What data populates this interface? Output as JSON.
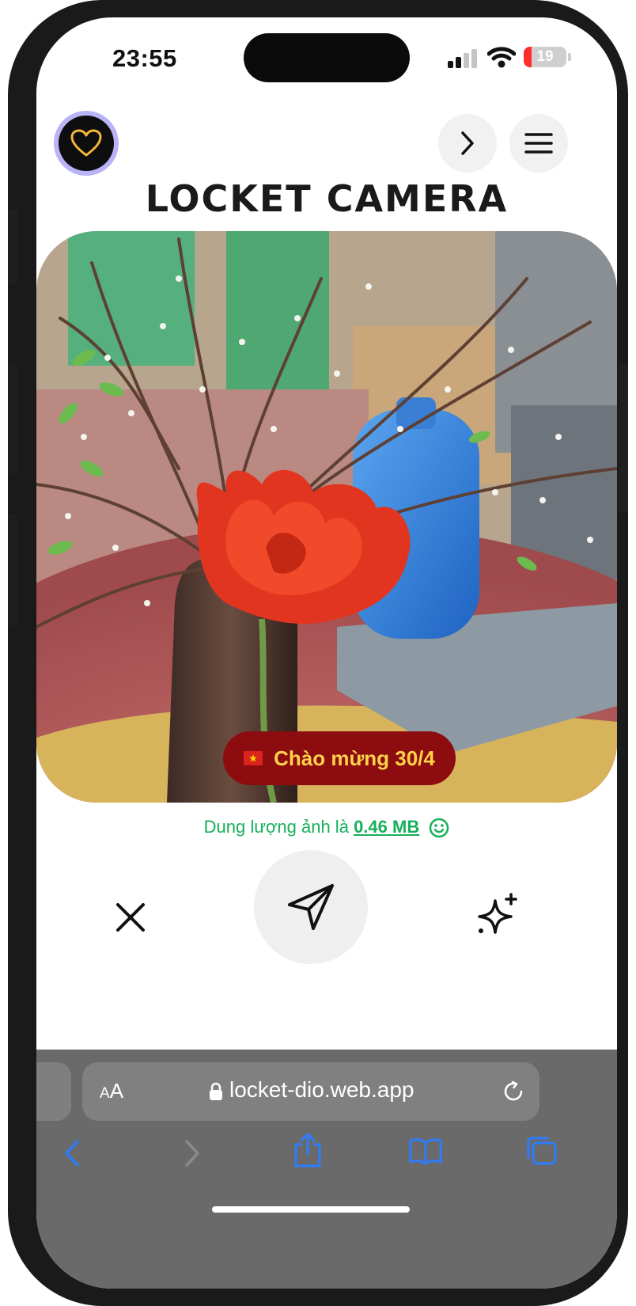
{
  "status_bar": {
    "time": "23:55",
    "battery_level": "19",
    "battery_percent": 19,
    "signal_bars_active": 2,
    "signal_bars_total": 4
  },
  "header": {
    "app_title": "LOCKET CAMERA",
    "avatar_icon": "heart-icon",
    "next_icon": "chevron-right-icon",
    "menu_icon": "hamburger-menu-icon"
  },
  "photo": {
    "caption": "Chào mừng 30/4",
    "caption_flag": "vietnam-flag-icon",
    "caption_bg_color": "#8c0c10",
    "caption_text_color": "#ffd24a"
  },
  "size_info": {
    "prefix": "Dung lượng ảnh là",
    "value": "0.46 MB",
    "color": "#16b05a"
  },
  "actions": {
    "close_icon": "close-icon",
    "send_icon": "send-icon",
    "sparkle_icon": "sparkle-icon"
  },
  "browser": {
    "aa_small": "A",
    "aa_large": "A",
    "url": "locket-dio.web.app",
    "accent_color": "#2f7cf6"
  }
}
